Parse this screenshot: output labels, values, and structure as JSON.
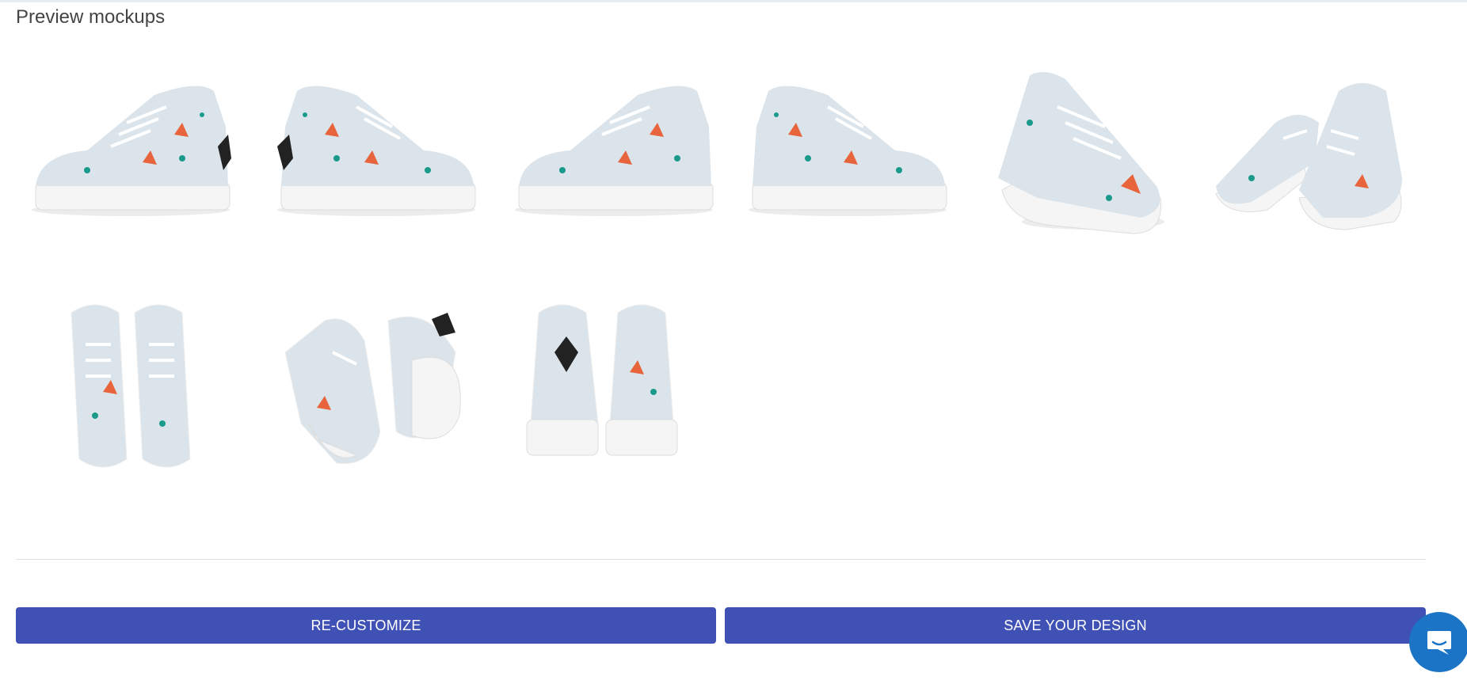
{
  "page": {
    "title": "Preview mockups"
  },
  "mockups": [
    {
      "view": "side-outer-right"
    },
    {
      "view": "side-inner-left"
    },
    {
      "view": "side-inner-right"
    },
    {
      "view": "side-outer-left"
    },
    {
      "view": "three-quarter-front"
    },
    {
      "view": "pair-angle"
    },
    {
      "view": "top-pair"
    },
    {
      "view": "pair-sole-up"
    },
    {
      "view": "back-pair"
    }
  ],
  "actions": {
    "recustomize_label": "RE-CUSTOMIZE",
    "save_label": "SAVE YOUR DESIGN"
  },
  "colors": {
    "primary": "#3f51b5",
    "chat": "#1b74c5",
    "shoe_base": "#dbe4ea",
    "accent_orange": "#e8643c",
    "accent_teal": "#1a9a8a"
  },
  "chat": {
    "icon": "chat-icon"
  }
}
